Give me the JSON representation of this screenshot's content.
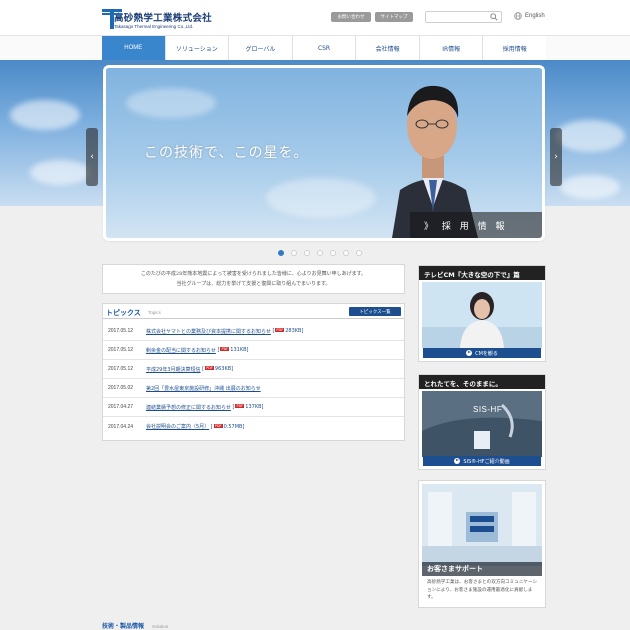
{
  "header": {
    "company_name_jp": "高砂熱学工業株式会社",
    "company_name_en": "Takasago Thermal Engineering Co.,Ltd.",
    "contact_label": "お問い合わせ",
    "sitemap_label": "サイトマップ",
    "search_placeholder": "",
    "language_label": "English"
  },
  "nav": {
    "items": [
      "HOME",
      "ソリューション",
      "グローバル",
      "CSR",
      "会社情報",
      "IR情報",
      "採用情報"
    ]
  },
  "hero": {
    "copy": "この技術で、この星を。",
    "recruit_label": "》 採 用 情 報",
    "prev_label": "‹",
    "next_label": "›",
    "slide_count": 7,
    "active_slide": 1
  },
  "notice": {
    "line1": "このたびの平成28年熊本地震によって被害を受けられました皆様に、心よりお見舞い申しあげます。",
    "line2": "当社グループは、総力を挙げて支援と復興に取り組んでまいります。"
  },
  "topics": {
    "title": "トピックス",
    "title_en": "Topics",
    "more_label": "トピックス一覧",
    "items": [
      {
        "date": "2017.05.12",
        "text": "株式会社ヤマトとの業務及び資本提携に関するお知らせ",
        "size": "283KB]"
      },
      {
        "date": "2017.05.12",
        "text": "剰余金の配当に関するお知らせ",
        "size": "131KB]"
      },
      {
        "date": "2017.05.12",
        "text": "平成29年3月期決算短信",
        "size": "963KB]"
      },
      {
        "date": "2017.05.02",
        "text": "第2回「豊水屋東京施設研修」沖縄 出展のお知らせ",
        "size": ""
      },
      {
        "date": "2017.04.27",
        "text": "連結業績予想の修正に関するお知らせ",
        "size": "137KB]"
      },
      {
        "date": "2017.04.24",
        "text": "会社説明会のご案内（5月）",
        "size": "0.57MB]"
      }
    ],
    "pdf_label": "PDF",
    "bracket_open": "["
  },
  "side": {
    "cm": {
      "title": "テレビCM『大きな空の下で』篇",
      "button": "CMを観る"
    },
    "sis": {
      "title": "とれたてを、そのままに。",
      "product": "SIS-HF",
      "button": "SIS®-HFご紹介動画"
    },
    "support": {
      "title": "お客さまサポート",
      "desc": "高砂熱学工業は、お客さまとの双方向コミュニケーションにより、お客さま施設の運用最適化に貢献します。"
    }
  },
  "solution": {
    "title": "技術・製品情報",
    "title_en": "Solution"
  },
  "colors": {
    "brand": "#1d4e8f",
    "nav_active": "#3a86cc",
    "pdf": "#d02a2a"
  }
}
